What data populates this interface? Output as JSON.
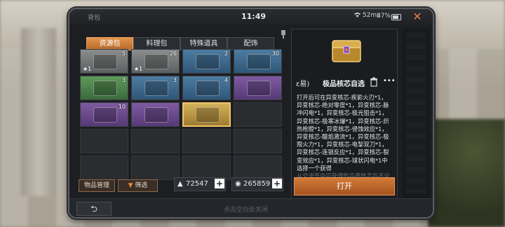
{
  "status": {
    "title": "背包",
    "time": "11:49",
    "network": "52ms",
    "battery": "87%"
  },
  "tabs": [
    {
      "label": "资源包",
      "active": true
    },
    {
      "label": "料理包",
      "active": false
    },
    {
      "label": "特殊道具",
      "active": false
    },
    {
      "label": "配饰",
      "active": false
    }
  ],
  "slots": [
    {
      "count": "5",
      "star": "★1",
      "rarity": "r-white",
      "icon": "wood-planks-icon"
    },
    {
      "count": "26",
      "star": "★1",
      "rarity": "r-white",
      "icon": "metal-parts-icon"
    },
    {
      "count": "2",
      "star": "",
      "rarity": "r-blue",
      "icon": "wrench-icon"
    },
    {
      "count": "30",
      "star": "",
      "rarity": "r-blue",
      "icon": "supply-box-icon"
    },
    {
      "count": "3",
      "star": "",
      "rarity": "r-green",
      "icon": "grenade-icon"
    },
    {
      "count": "3",
      "star": "",
      "rarity": "r-blue",
      "icon": "metal-crate-icon"
    },
    {
      "count": "4",
      "star": "",
      "rarity": "r-blue",
      "icon": "berries-icon"
    },
    {
      "count": "",
      "star": "",
      "rarity": "r-purple",
      "icon": "weapon-parts-icon"
    },
    {
      "count": "10",
      "star": "",
      "rarity": "r-purple",
      "icon": "supply-box-icon"
    },
    {
      "count": "",
      "star": "",
      "rarity": "r-purple",
      "icon": "purple-crate-icon"
    },
    {
      "count": "",
      "star": "",
      "rarity": "r-gold",
      "icon": "gold-chest-icon",
      "selected": true
    },
    {
      "count": "",
      "star": "",
      "rarity": "",
      "icon": ""
    },
    {
      "count": "",
      "star": "",
      "rarity": "",
      "icon": ""
    },
    {
      "count": "",
      "star": "",
      "rarity": "",
      "icon": ""
    },
    {
      "count": "",
      "star": "",
      "rarity": "",
      "icon": ""
    },
    {
      "count": "",
      "star": "",
      "rarity": "",
      "icon": ""
    },
    {
      "count": "",
      "star": "",
      "rarity": "",
      "icon": ""
    },
    {
      "count": "",
      "star": "",
      "rarity": "",
      "icon": ""
    },
    {
      "count": "",
      "star": "",
      "rarity": "",
      "icon": ""
    },
    {
      "count": "",
      "star": "",
      "rarity": "",
      "icon": ""
    }
  ],
  "actions": {
    "manage": "物品管理",
    "filter": "筛选"
  },
  "currency": {
    "primary": "72547",
    "secondary": "265859"
  },
  "detail": {
    "prefix": "ɛ易)",
    "name": "极品核芯自选",
    "lines": [
      "打开后可在异变核芯-疾影火刃*1，",
      "异变核芯-绝对零度*1，异变核芯-脉",
      "冲闪电*1，异变核芯-极光狙击*1，",
      "异变核芯-极寒冰爆*1，异变核芯-炽",
      "热枪膛*1，异变核芯-侵蚀效应*1，",
      "异变核芯-酸焰激流*1，异变核芯-极",
      "限火力*1，异变核芯-电掣双刀*1，",
      "异变核芯-连锁反应*1，异变核芯-裂",
      "变效应*1，异变核芯-球状闪电*1中",
      "选择一个获得"
    ],
    "faded": "从交流签中可获得的品质核芯后不论",
    "open_label": "打开"
  },
  "bottom": {
    "hint": "点击空白处关闭"
  }
}
